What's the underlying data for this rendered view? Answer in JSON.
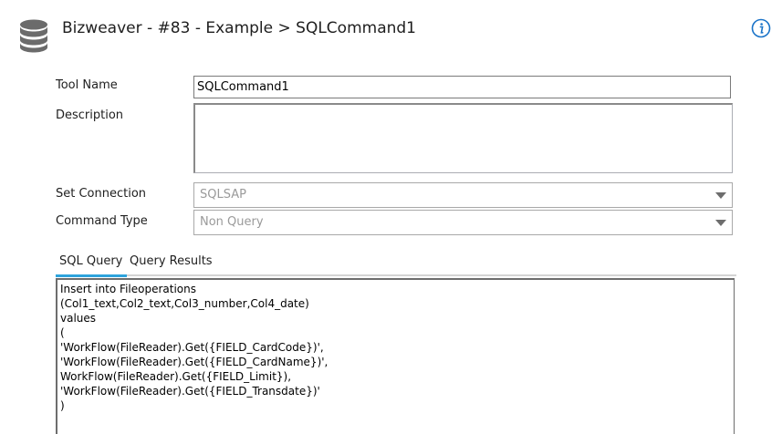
{
  "header": {
    "title": "Bizweaver - #83 - Example > SQLCommand1",
    "icon": "database-icon",
    "info_icon": "info-icon",
    "accent_color": "#1a73c8"
  },
  "form": {
    "tool_name": {
      "label": "Tool Name",
      "value": "SQLCommand1"
    },
    "description": {
      "label": "Description",
      "value": ""
    },
    "set_connection": {
      "label": "Set Connection",
      "value": "SQLSAP"
    },
    "command_type": {
      "label": "Command Type",
      "value": "Non Query"
    }
  },
  "tabs": [
    {
      "label": "SQL Query",
      "active": true
    },
    {
      "label": "Query Results",
      "active": false
    }
  ],
  "tab_accent_color": "#2ea3dc",
  "sql": {
    "lines": [
      "Insert into Fileoperations",
      "(Col1_text,Col2_text,Col3_number,Col4_date)",
      "values",
      "(",
      "'WorkFlow(FileReader).Get({FIELD_CardCode})',",
      "'WorkFlow(FileReader).Get({FIELD_CardName})',",
      "WorkFlow(FileReader).Get({FIELD_Limit}),",
      "'WorkFlow(FileReader).Get({FIELD_Transdate})'",
      ")"
    ]
  }
}
